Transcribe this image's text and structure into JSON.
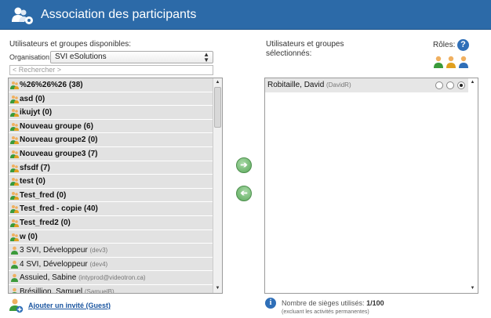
{
  "header": {
    "title": "Association des participants",
    "icon": "users-gear-icon",
    "color": "#2c6aa8"
  },
  "available": {
    "label": "Utilisateurs et groupes disponibles:",
    "org_label": "Organisation:",
    "org_value": "SVI eSolutions",
    "search_placeholder": "< Rechercher >",
    "items": [
      {
        "type": "group",
        "name": "%26%26%26 (38)",
        "sub": ""
      },
      {
        "type": "group",
        "name": "asd (0)",
        "sub": ""
      },
      {
        "type": "group",
        "name": "ikujyt (0)",
        "sub": ""
      },
      {
        "type": "group",
        "name": "Nouveau groupe (6)",
        "sub": ""
      },
      {
        "type": "group",
        "name": "Nouveau groupe2 (0)",
        "sub": ""
      },
      {
        "type": "group",
        "name": "Nouveau groupe3 (7)",
        "sub": ""
      },
      {
        "type": "group",
        "name": "sfsdf (7)",
        "sub": ""
      },
      {
        "type": "group",
        "name": "test (0)",
        "sub": ""
      },
      {
        "type": "group",
        "name": "Test_fred (0)",
        "sub": ""
      },
      {
        "type": "group",
        "name": "Test_fred - copie (40)",
        "sub": ""
      },
      {
        "type": "group",
        "name": "Test_fred2 (0)",
        "sub": ""
      },
      {
        "type": "group",
        "name": "w (0)",
        "sub": ""
      },
      {
        "type": "user",
        "name": "3 SVI, Développeur",
        "sub": "(dev3)"
      },
      {
        "type": "user",
        "name": "4 SVI, Développeur",
        "sub": "(dev4)"
      },
      {
        "type": "user",
        "name": "Assuied, Sabine",
        "sub": "(intyprod@videotron.ca)"
      },
      {
        "type": "user",
        "name": "Brésillion, Samuel",
        "sub": "(SamuelB)"
      }
    ]
  },
  "buttons": {
    "add": "➔",
    "remove": "➔"
  },
  "selected": {
    "label_line1": "Utilisateurs et groupes",
    "label_line2": "sélectionnés:",
    "roles_label": "Rôles:",
    "items": [
      {
        "name": "Robitaille, David",
        "sub": "(DavidR)",
        "role_selected": 3
      }
    ]
  },
  "footer": {
    "guest_link": "Ajouter un invité (Guest)",
    "seats_label": "Nombre de sièges utilisés:",
    "seats_value": "1/100",
    "seats_note": "(excluant les activités permanentes)"
  }
}
